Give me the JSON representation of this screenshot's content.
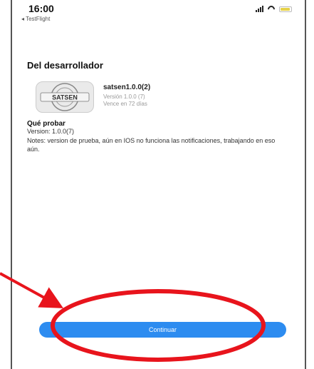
{
  "status_bar": {
    "time": "16:00",
    "back_label": "◂ TestFlight",
    "battery_color": "#e6d24a"
  },
  "section": {
    "title": "Del desarrollador"
  },
  "app": {
    "logo_text": "SATSEN",
    "name": "satsen1.0.0(2)",
    "version": "Versión 1.0.0 (7)",
    "expires": "Vence en 72 días"
  },
  "what_to_test": {
    "title": "Qué probar",
    "version": "Version: 1.0.0(7)",
    "notes": "Notes: version de prueba, aún en IOS no funciona las notificaciones, trabajando en eso aún."
  },
  "continue_button": {
    "label": "Continuar",
    "color": "#2d8cf0"
  },
  "annotation": {
    "color": "#e8141c"
  }
}
